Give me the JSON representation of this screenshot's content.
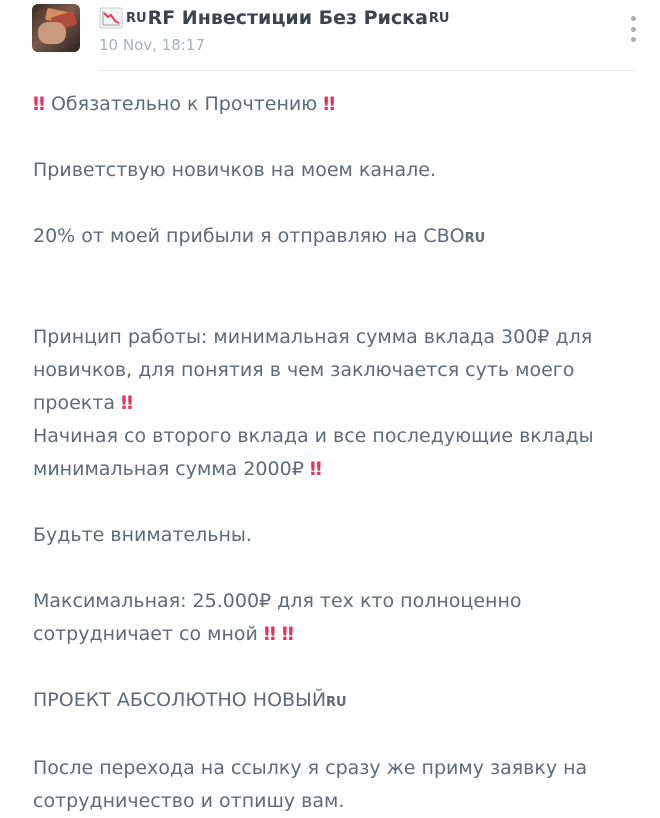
{
  "post": {
    "channel_prefix": "RU",
    "channel_name": "RF Инвестиции Без Риска",
    "channel_suffix": "RU",
    "date": "10 Nov, 18:17",
    "chart_icon": "chart-decreasing-icon",
    "menu_icon": "more-vertical-icon"
  },
  "message": {
    "excl": "‼",
    "line1": "Обязательно к Прочтению",
    "line2": "Приветствую новичков на моем канале.",
    "line3": "20% от моей прибыли я отправляю на СВО",
    "line3_suffix": "RU",
    "line4a": "Принцип работы: минимальная сумма вклада 300₽ для",
    "line4b": "новичков, для понятия в чем заключается суть моего",
    "line4c": "проекта",
    "line5a": "Начиная со второго вклада и все последующие вклады",
    "line5b": "минимальная сумма 2000₽",
    "line6": "Будьте внимательны.",
    "line7a": "Максимальная: 25.000₽ для тех кто полноценно",
    "line7b": "сотрудничает со мной",
    "line8": "ПРОЕКТ АБСОЛЮТНО НОВЫЙ",
    "line8_suffix": "RU",
    "line9a": "После перехода на ссылку я сразу же приму заявку на",
    "line9b": "сотрудничество и отпишу вам."
  },
  "colors": {
    "accent_excl": "#e8305a",
    "text": "#5f6a75",
    "muted": "#a9b0b8"
  }
}
